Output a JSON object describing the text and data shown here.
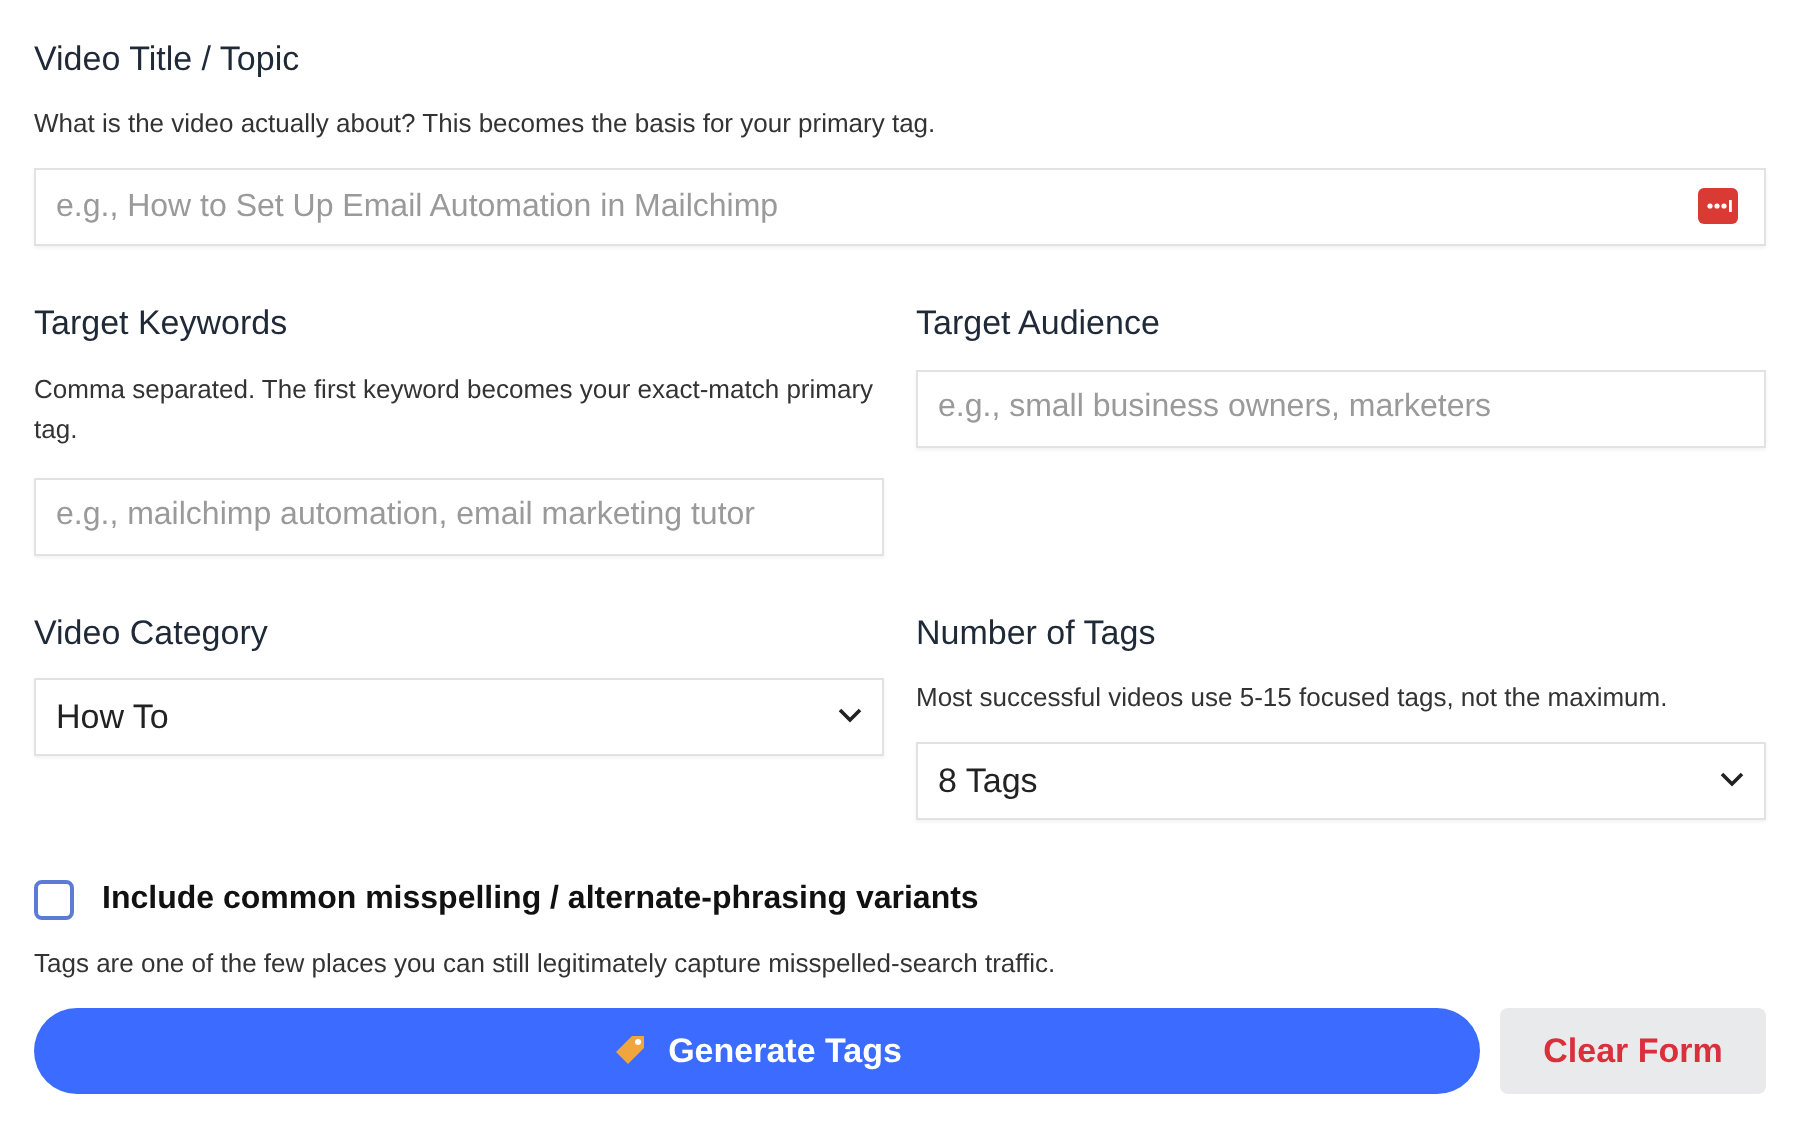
{
  "title_field": {
    "label": "Video Title / Topic",
    "help": "What is the video actually about? This becomes the basis for your primary tag.",
    "placeholder": "e.g., How to Set Up Email Automation in Mailchimp"
  },
  "keywords_field": {
    "label": "Target Keywords",
    "help": "Comma separated. The first keyword becomes your exact-match primary tag.",
    "placeholder": "e.g., mailchimp automation, email marketing tutor"
  },
  "audience_field": {
    "label": "Target Audience",
    "placeholder": "e.g., small business owners, marketers"
  },
  "category_field": {
    "label": "Video Category",
    "value": "How To"
  },
  "tags_count_field": {
    "label": "Number of Tags",
    "help": "Most successful videos use 5-15 focused tags, not the maximum.",
    "value": "8 Tags"
  },
  "misspelling_option": {
    "label": "Include common misspelling / alternate-phrasing variants",
    "checked": false,
    "help": "Tags are one of the few places you can still legitimately capture misspelled-search traffic."
  },
  "buttons": {
    "generate": "Generate Tags",
    "clear": "Clear Form"
  }
}
